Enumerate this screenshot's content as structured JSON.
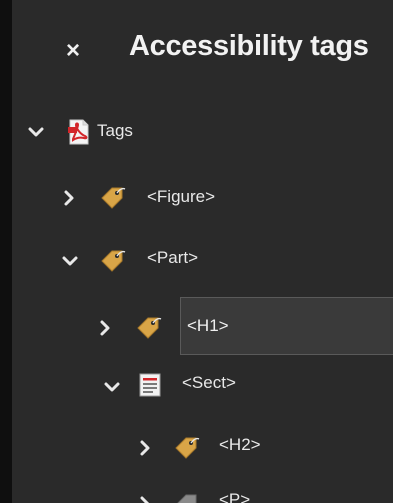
{
  "panel": {
    "title": "Accessibility tags",
    "close_label": "×"
  },
  "tree": {
    "root": {
      "label": "Tags",
      "expanded": true,
      "icon": "pdf-document-icon"
    },
    "figure": {
      "label": "<Figure>",
      "expanded": false,
      "icon": "tag-icon"
    },
    "part": {
      "label": "<Part>",
      "expanded": true,
      "icon": "tag-icon"
    },
    "h1": {
      "value": "<H1>",
      "expanded": false,
      "icon": "tag-icon",
      "editing": true
    },
    "sect": {
      "label": "<Sect>",
      "expanded": true,
      "icon": "section-icon"
    },
    "h2": {
      "label": "<H2>",
      "expanded": false,
      "icon": "tag-icon"
    },
    "p": {
      "label": "<P>",
      "expanded": false,
      "icon": "tag-icon"
    }
  },
  "colors": {
    "background": "#2a2a2a",
    "tag_icon": "#d9a547",
    "pdf_red": "#d3262a",
    "edit_field": "#3a3a3a"
  }
}
